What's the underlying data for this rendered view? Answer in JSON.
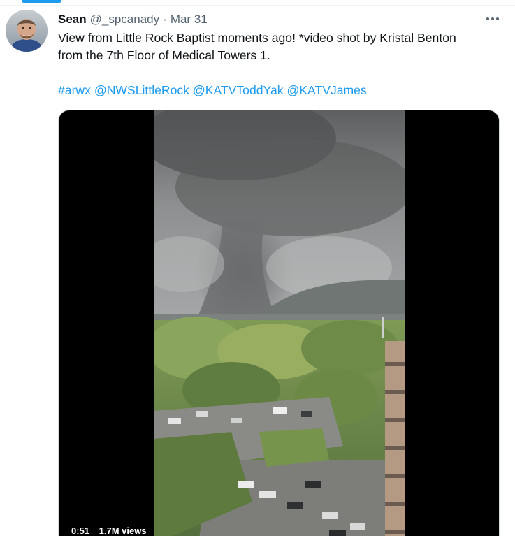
{
  "tweet": {
    "author": {
      "name": "Sean",
      "handle": "@_spcanady",
      "separator": "·",
      "timestamp": "Mar 31"
    },
    "text_lines": [
      "View from Little Rock Baptist moments ago! *video shot by Kristal Benton",
      "from the 7th Floor of Medical Towers 1."
    ],
    "tags": [
      "#arwx",
      "@NWSLittleRock",
      "@KATVToddYak",
      "@KATVJames"
    ],
    "media": {
      "duration": "0:51",
      "views": "1.7M views",
      "content": "video-thumbnail-tornado"
    },
    "icons": {
      "more": "more-dots-icon",
      "avatar": "user-avatar"
    },
    "colors": {
      "accent": "#1d9bf0",
      "text_primary": "#0f1419",
      "text_secondary": "#536471"
    }
  }
}
